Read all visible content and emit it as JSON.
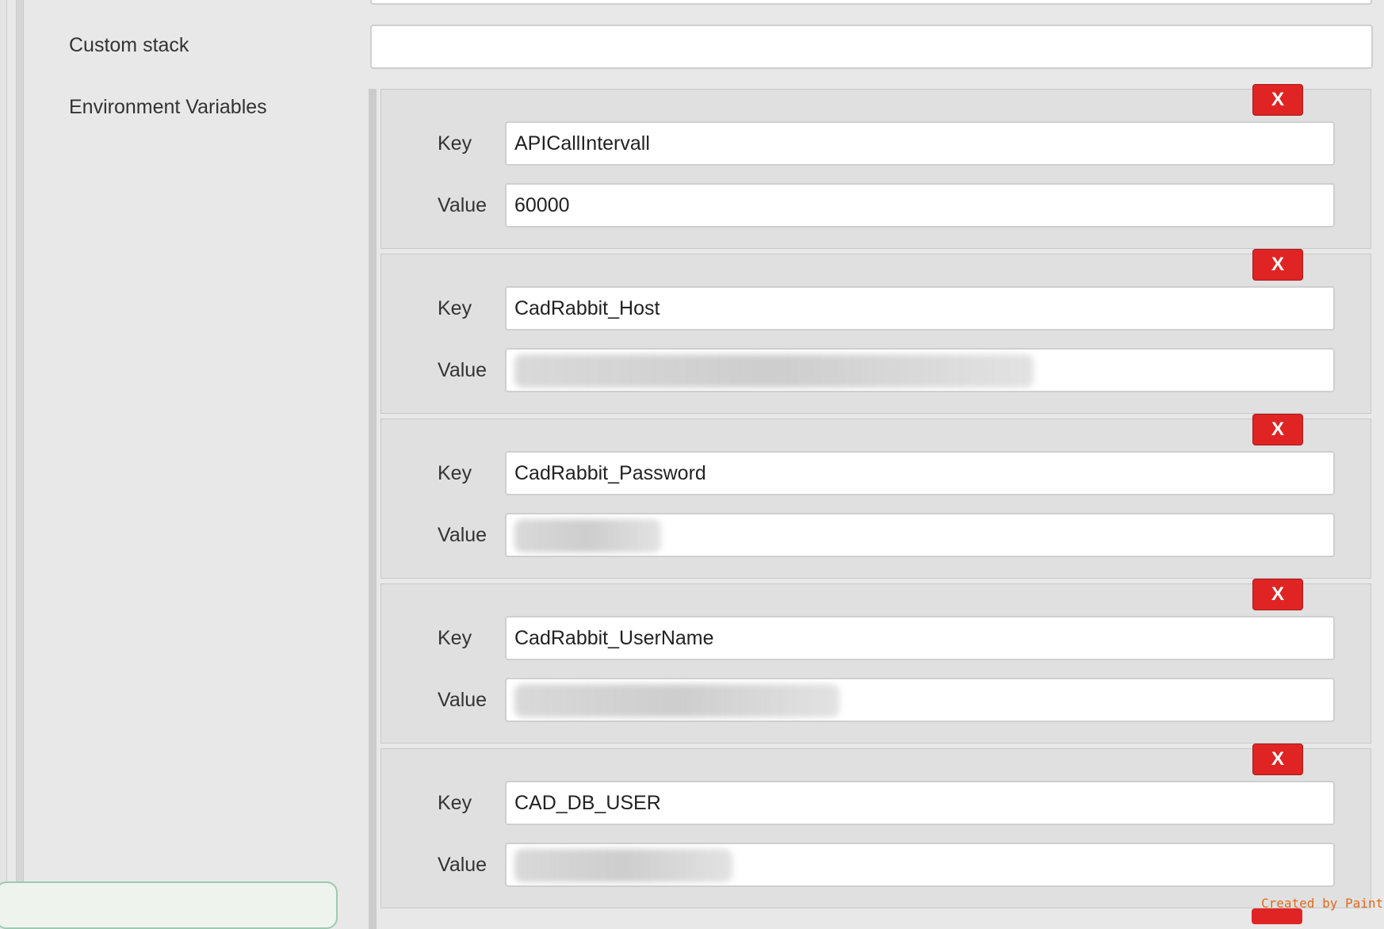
{
  "form": {
    "custom_stack": {
      "label": "Custom stack",
      "value": ""
    },
    "env_vars_label": "Environment Variables",
    "key_label": "Key",
    "value_label": "Value",
    "delete_label": "X",
    "entries": [
      {
        "key": "APICallIntervall",
        "value": "60000",
        "value_blurred": false
      },
      {
        "key": "CadRabbit_Host",
        "value": "",
        "value_blurred": true
      },
      {
        "key": "CadRabbit_Password",
        "value": "",
        "value_blurred": true
      },
      {
        "key": "CadRabbit_UserName",
        "value": "",
        "value_blurred": true
      },
      {
        "key": "CAD_DB_USER",
        "value": "",
        "value_blurred": true
      }
    ]
  },
  "watermark": "Created by Paint X",
  "colors": {
    "delete_button": "#e02424",
    "background": "#e8e8e8",
    "panel_border": "#9ccab0"
  }
}
